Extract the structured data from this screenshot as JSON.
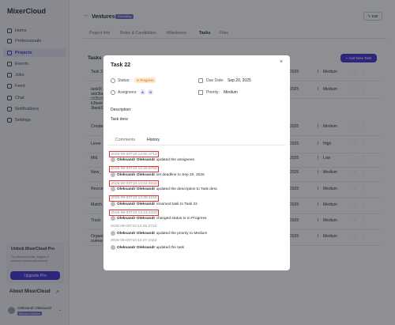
{
  "brand": "MixerCloud",
  "sidebar": {
    "items": [
      {
        "label": "Home",
        "active": false
      },
      {
        "label": "Professionals",
        "active": false
      },
      {
        "label": "Projects",
        "active": true
      },
      {
        "label": "Events",
        "active": false
      },
      {
        "label": "Jobs",
        "active": false
      },
      {
        "label": "Feed",
        "active": false
      },
      {
        "label": "Chat",
        "active": false
      },
      {
        "label": "Notifications",
        "active": false
      },
      {
        "label": "Settings",
        "active": false
      }
    ],
    "pro": {
      "title": "Unlock MixerCloud Pro",
      "desc": "Try advanced tools, insights & premium community features.",
      "button": "Upgrade Pro"
    },
    "about": "About MixerCloud",
    "user": {
      "name": "Oleksandr Oleksandr",
      "role": "Standard Member"
    }
  },
  "project": {
    "title": "Ventures",
    "badge": "Recruiting",
    "edit": "Edit",
    "tabs": [
      "Project Info",
      "Roles & Candidates",
      "Milestones",
      "Tasks",
      "Files"
    ],
    "active_tab": "Tasks"
  },
  "tasks": {
    "heading": "Tasks",
    "add_button": "+ Add New Task",
    "rows": [
      {
        "name": "Task 2",
        "date": "2025",
        "priority": "Medium"
      },
      {
        "name": "task3t ask3ta sk3task k3task 3task3",
        "date": "2025",
        "priority": "Medium"
      },
      {
        "name": "Create",
        "date": "2025",
        "priority": "Medium"
      },
      {
        "name": "Lever",
        "date": "2025",
        "priority": "High"
      },
      {
        "name": "Mid",
        "date": "2025",
        "priority": "Low"
      },
      {
        "name": "New_",
        "date": "2025",
        "priority": "Medium"
      },
      {
        "name": "Recrui",
        "date": "2025",
        "priority": "Medium"
      },
      {
        "name": "Match",
        "date": "2025",
        "priority": "Medium"
      },
      {
        "name": "Track",
        "date": "2025",
        "priority": "Medium"
      },
      {
        "name": "Organi outrea",
        "date": "2025",
        "priority": "Medium"
      }
    ]
  },
  "modal": {
    "title": "Task 22",
    "close": "×",
    "status_label": "Status:",
    "status_value": "In Progress",
    "due_label": "Due Date:",
    "due_value": "Sep 20, 2025",
    "assignees_label": "Assignees:",
    "assignees": [
      "A",
      "O"
    ],
    "priority_label": "Priority:",
    "priority_value": "Medium",
    "description_label": "Description:",
    "description_value": "Task desc",
    "tabs": [
      "Comments",
      "History"
    ],
    "active_tab": "History",
    "history": [
      {
        "ts": "2025-09-03T10:14:55.371Z",
        "user": "Oleksandr Oleksandr",
        "text": "updated the assignees",
        "highlight": true
      },
      {
        "ts": "2025-09-03T10:14:36.878Z",
        "user": "Oleksandr Oleksandr",
        "text": "set deadline to Sep 20, 2025",
        "highlight": true
      },
      {
        "ts": "2025-09-03T10:14:02.404Z",
        "user": "Oleksandr Oleksandr",
        "text": "updated the description to Task desc",
        "highlight": true
      },
      {
        "ts": "2025-09-03T10:13:38.115Z",
        "user": "Oleksandr Oleksandr",
        "text": "renamed task to Task 22",
        "highlight": true
      },
      {
        "ts": "2025-09-03T10:13:24.232Z",
        "user": "Oleksandr Oleksandr",
        "text": "changed status to In Progress",
        "highlight": true
      },
      {
        "ts": "2025-09-03T10:12:45.271Z",
        "user": "Oleksandr Oleksandr",
        "text": "updated the priority to Medium",
        "highlight": false
      },
      {
        "ts": "2025-09-03T10:12:27.102Z",
        "user": "Oleksandr Oleksandr",
        "text": "updated the task",
        "highlight": false
      }
    ]
  },
  "colors": {
    "accent": "#3b2fd0",
    "highlight_border": "#e03434",
    "status": "#d06a00"
  }
}
